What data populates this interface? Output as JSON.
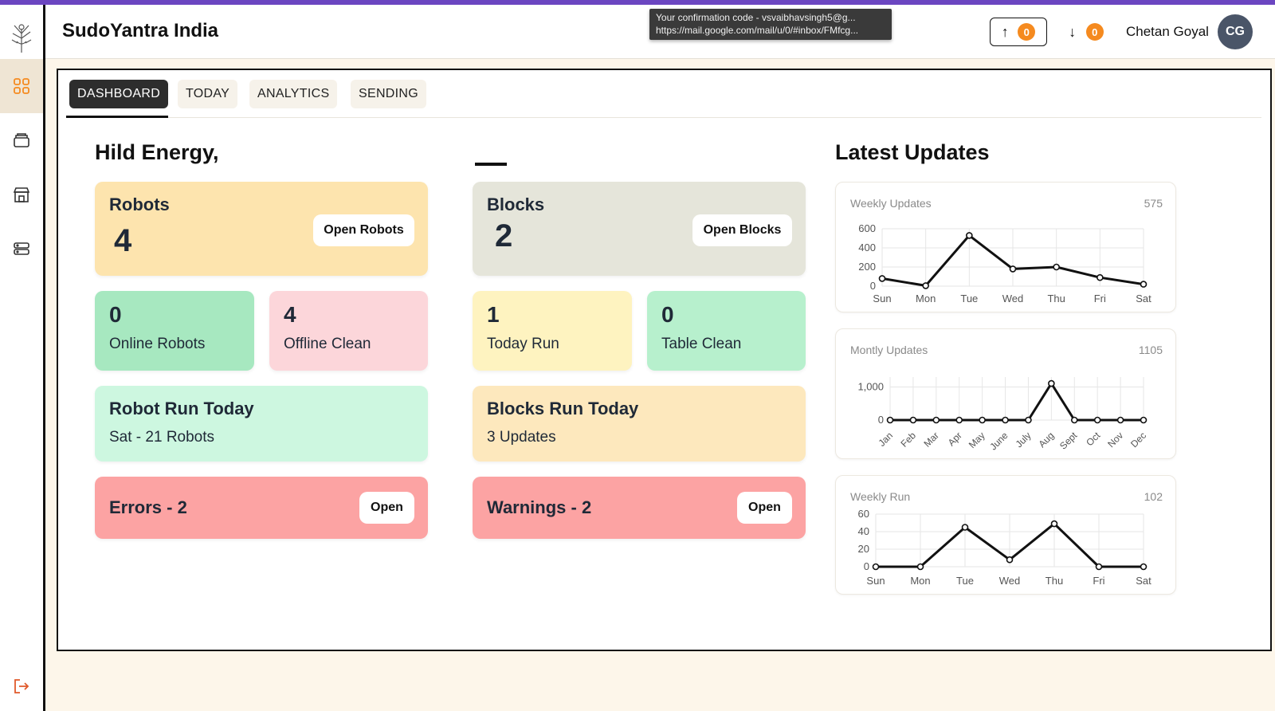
{
  "app": {
    "brand": "SudoYantra India",
    "tooltip_line1": "Your confirmation code - vsvaibhavsingh5@g...",
    "tooltip_line2": "https://mail.google.com/mail/u/0/#inbox/FMfcg...",
    "upload_count": "0",
    "download_count": "0",
    "user_name": "Chetan Goyal",
    "user_initials": "CG"
  },
  "sidebar": {
    "items": [
      {
        "icon": "dashboard-grid-icon",
        "active": true
      },
      {
        "icon": "layers-icon",
        "active": false
      },
      {
        "icon": "store-icon",
        "active": false
      },
      {
        "icon": "database-icon",
        "active": false
      }
    ],
    "logout_icon": "logout-icon"
  },
  "tabs": [
    {
      "label": "DASHBOARD",
      "active": true
    },
    {
      "label": "TODAY",
      "active": false
    },
    {
      "label": "ANALYTICS",
      "active": false
    },
    {
      "label": "SENDING",
      "active": false
    }
  ],
  "left": {
    "heading": "Hild Energy,",
    "robots": {
      "label": "Robots",
      "value": "4",
      "button": "Open Robots"
    },
    "online": {
      "value": "0",
      "label": "Online Robots"
    },
    "offline": {
      "value": "4",
      "label": "Offline Clean"
    },
    "run_today": {
      "label": "Robot Run Today",
      "sub": "Sat - 21 Robots"
    },
    "errors": {
      "label": "Errors - 2",
      "button": "Open"
    }
  },
  "middle": {
    "blocks": {
      "label": "Blocks",
      "value": "2",
      "button": "Open Blocks"
    },
    "today_run": {
      "value": "1",
      "label": "Today Run"
    },
    "table_clean": {
      "value": "0",
      "label": "Table Clean"
    },
    "run_today": {
      "label": "Blocks Run Today",
      "sub": "3 Updates"
    },
    "warnings": {
      "label": "Warnings - 2",
      "button": "Open"
    }
  },
  "right": {
    "heading": "Latest Updates"
  },
  "colors": {
    "robots_card": "#fde4ae",
    "blocks_card": "#e5e5da",
    "online_card": "#a7e8c0",
    "offline_card": "#fcd6da",
    "today_run_card": "#fef3c0",
    "table_clean_card": "#b7f0cd",
    "robot_run_card": "#cdf7e0",
    "blocks_run_card": "#fde8bd",
    "alert_card": "#fca3a3",
    "accent_orange": "#f58a1f"
  },
  "chart_data": [
    {
      "type": "line",
      "title": "Weekly Updates",
      "total": "575",
      "categories": [
        "Sun",
        "Mon",
        "Tue",
        "Wed",
        "Thu",
        "Fri",
        "Sat"
      ],
      "values": [
        80,
        5,
        530,
        180,
        200,
        90,
        20
      ],
      "yticks": [
        "0",
        "200",
        "400",
        "600"
      ],
      "ylim": [
        0,
        600
      ],
      "grid": true
    },
    {
      "type": "line",
      "title": "Montly Updates",
      "total": "1105",
      "categories": [
        "Jan",
        "Feb",
        "Mar",
        "Apr",
        "May",
        "June",
        "July",
        "Aug",
        "Sept",
        "Oct",
        "Nov",
        "Dec"
      ],
      "values": [
        0,
        0,
        0,
        0,
        0,
        0,
        0,
        1105,
        0,
        0,
        0,
        0
      ],
      "yticks": [
        "0",
        "1,000"
      ],
      "ylim": [
        0,
        1300
      ],
      "grid": true
    },
    {
      "type": "line",
      "title": "Weekly Run",
      "total": "102",
      "categories": [
        "Sun",
        "Mon",
        "Tue",
        "Wed",
        "Thu",
        "Fri",
        "Sat"
      ],
      "values": [
        0,
        0,
        45,
        8,
        49,
        0,
        0
      ],
      "yticks": [
        "0",
        "20",
        "40",
        "60"
      ],
      "ylim": [
        0,
        60
      ],
      "grid": true
    }
  ]
}
